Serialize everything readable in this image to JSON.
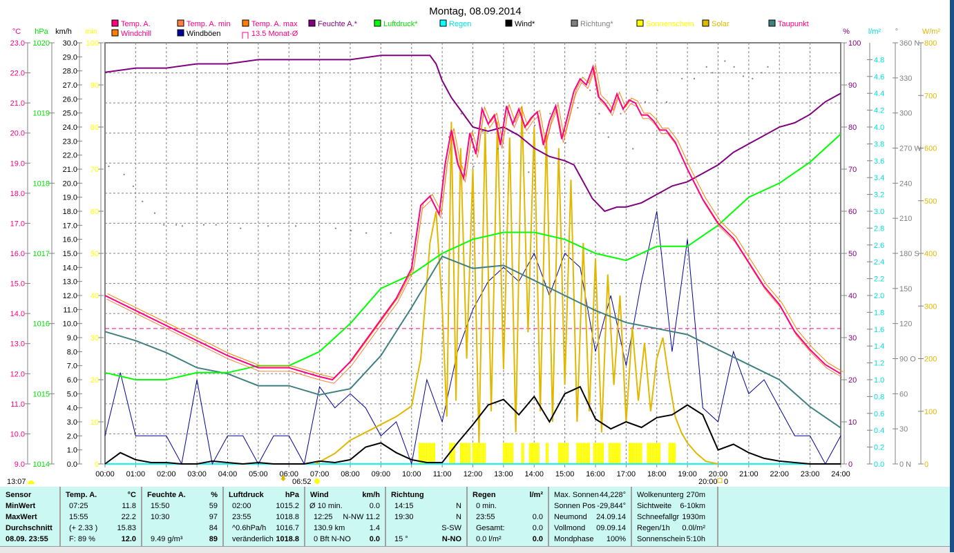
{
  "title": "Montag, 08.09.2014",
  "legend": [
    {
      "label": "Temp. A.",
      "color": "#ff0080",
      "text_color": "#ff0080"
    },
    {
      "label": "Temp. A. min",
      "color": "#ff8040",
      "text_color": "#ff0080"
    },
    {
      "label": "Temp. A. max",
      "color": "#ff8000",
      "text_color": "#ff0080"
    },
    {
      "label": "Feuchte A.*",
      "color": "#800080",
      "text_color": "#800080"
    },
    {
      "label": "Luftdruck*",
      "color": "#00ff00",
      "text_color": "#00e000"
    },
    {
      "label": "Regen",
      "color": "#00ffff",
      "text_color": "#00e0e0"
    },
    {
      "label": "Wind*",
      "color": "#000000",
      "text_color": "#000000"
    },
    {
      "label": "Richtung*",
      "color": "#808080",
      "text_color": "#808080"
    },
    {
      "label": "Sonnenschein",
      "color": "#ffff00",
      "text_color": "#ffff00"
    },
    {
      "label": "Solar",
      "color": "#e0b800",
      "text_color": "#e0b800"
    },
    {
      "label": "Taupunkt",
      "color": "#408080",
      "text_color": "#ff0080"
    },
    {
      "label": "Windchill",
      "color": "#ff8000",
      "text_color": "#ff0080"
    },
    {
      "label": "Windböen",
      "color": "#000099",
      "text_color": "#000000"
    },
    {
      "label": "13.5 Monat-Ø",
      "color": "#ff0080",
      "text_color": "#ff0080"
    }
  ],
  "axis_units": {
    "temp": "°C",
    "pressure": "hPa",
    "wind": "km/h",
    "minutes": "min",
    "humidity": "%",
    "rain": "l/m²",
    "direction": "°",
    "solar": "W/m²"
  },
  "markers": {
    "moon_time": "13:07",
    "sunrise": "06:52",
    "sunset": "20:00",
    "sunset_value": "0"
  },
  "chart_data": {
    "type": "line",
    "title": "Montag, 08.09.2014",
    "x_label": "",
    "x_ticks": [
      "00:00",
      "01:00",
      "02:00",
      "03:00",
      "04:00",
      "05:00",
      "06:00",
      "07:00",
      "08:00",
      "09:00",
      "10:00",
      "11:00",
      "12:00",
      "13:00",
      "14:00",
      "15:00",
      "16:00",
      "17:00",
      "18:00",
      "19:00",
      "20:00",
      "21:00",
      "22:00",
      "23:00",
      "24:00"
    ],
    "xlim_hours": [
      0,
      24
    ],
    "axes": {
      "temp": {
        "range": [
          9.0,
          23.0
        ],
        "step": 1.0,
        "decimals": 1,
        "color": "#ff0080"
      },
      "pressure": {
        "range": [
          1014,
          1020
        ],
        "step": 1,
        "decimals": 0,
        "color": "#00e000"
      },
      "wind": {
        "range": [
          0.0,
          30.0
        ],
        "step": 1.0,
        "decimals": 1,
        "color": "#000000"
      },
      "minutes": {
        "range": [
          0,
          100
        ],
        "step": 10,
        "decimals": 0,
        "color": "#ffff00"
      },
      "humidity": {
        "range": [
          0,
          100
        ],
        "step": 10,
        "decimals": 0,
        "color": "#800080"
      },
      "rain": {
        "range": [
          0.0,
          5.0
        ],
        "step": 0.2,
        "max_label": 4.8,
        "decimals": 1,
        "color": "#00e0e0"
      },
      "direction": {
        "range": [
          0,
          360
        ],
        "step": 30,
        "decimals": 0,
        "color": "#808080",
        "compass": {
          "0": "N",
          "90": "O",
          "180": "S",
          "270": "W",
          "360": "N"
        }
      },
      "solar": {
        "range": [
          0,
          800
        ],
        "step": 100,
        "decimals": 0,
        "color": "#e0b800"
      }
    },
    "grid": true,
    "monthly_avg_temp": 13.5,
    "series": [
      {
        "name": "Temp. A.",
        "axis": "temp",
        "color": "#ff0080",
        "x": [
          0,
          1,
          2,
          3,
          4,
          5,
          6,
          7,
          7.42,
          8,
          9,
          9.5,
          10,
          10.3,
          10.6,
          10.9,
          11.1,
          11.3,
          11.5,
          11.7,
          11.9,
          12.1,
          12.3,
          12.5,
          12.7,
          12.9,
          13.1,
          13.3,
          13.5,
          13.7,
          13.9,
          14.1,
          14.3,
          14.5,
          14.7,
          14.9,
          15.1,
          15.3,
          15.5,
          15.7,
          15.92,
          16.1,
          16.3,
          16.5,
          16.7,
          16.9,
          17.1,
          17.3,
          17.5,
          17.7,
          17.9,
          18.1,
          18.3,
          18.6,
          19,
          19.5,
          20,
          20.5,
          21,
          21.5,
          22,
          22.5,
          23,
          23.5,
          24
        ],
        "y": [
          14.6,
          14.1,
          13.6,
          13.1,
          12.6,
          12.2,
          12.2,
          11.9,
          11.8,
          12.4,
          13.8,
          14.5,
          15.5,
          17.6,
          17.9,
          17.3,
          19.0,
          20.1,
          19.0,
          18.5,
          20.0,
          19.3,
          20.8,
          20.3,
          20.6,
          19.6,
          20.9,
          20.3,
          20.8,
          20.2,
          20.5,
          20.7,
          19.6,
          20.4,
          20.9,
          19.8,
          20.6,
          21.4,
          21.8,
          21.6,
          22.2,
          21.2,
          21.0,
          20.7,
          21.3,
          20.8,
          21.1,
          21.0,
          20.6,
          20.6,
          20.4,
          20.1,
          20.1,
          19.7,
          18.8,
          17.8,
          17.0,
          16.5,
          15.7,
          14.9,
          14.3,
          13.4,
          12.8,
          12.3,
          12.0
        ]
      },
      {
        "name": "Feuchte A.*",
        "axis": "humidity",
        "color": "#800080",
        "x": [
          0,
          1,
          2,
          3,
          4,
          5,
          6,
          7,
          8,
          9,
          10,
          10.6,
          10.8,
          11,
          11.3,
          11.6,
          12,
          12.5,
          13,
          13.5,
          14,
          14.5,
          15,
          15.3,
          15.6,
          15.9,
          16.3,
          16.7,
          17,
          17.5,
          18,
          18.5,
          19,
          19.5,
          20,
          20.5,
          21,
          21.5,
          22,
          22.5,
          23,
          23.5,
          24
        ],
        "y": [
          93,
          94,
          94,
          95,
          95,
          96,
          96,
          96,
          96,
          97,
          97,
          97,
          95,
          91,
          87,
          84,
          80,
          79,
          80,
          78,
          75,
          73,
          72,
          71,
          67,
          63,
          60,
          61,
          61,
          62,
          64,
          66,
          67,
          69,
          71,
          74,
          76,
          78,
          80,
          81,
          83,
          86,
          88
        ]
      },
      {
        "name": "Luftdruck*",
        "axis": "pressure",
        "color": "#00ff00",
        "x": [
          0,
          1,
          2,
          3,
          4,
          5,
          6,
          7,
          8,
          9,
          10,
          11,
          12,
          13,
          14,
          15,
          16,
          17,
          18,
          19,
          20,
          21,
          22,
          23,
          24
        ],
        "y": [
          1015.3,
          1015.2,
          1015.2,
          1015.3,
          1015.3,
          1015.4,
          1015.4,
          1015.6,
          1016.0,
          1016.5,
          1016.7,
          1017.0,
          1017.2,
          1017.3,
          1017.3,
          1017.2,
          1017.0,
          1016.9,
          1017.1,
          1017.1,
          1017.4,
          1017.8,
          1018.0,
          1018.3,
          1018.7
        ]
      },
      {
        "name": "Taupunkt",
        "axis": "temp",
        "color": "#408080",
        "x": [
          0,
          1,
          2,
          3,
          4,
          5,
          6,
          7,
          8,
          9,
          10,
          11,
          12,
          13,
          14,
          15,
          16,
          17,
          18,
          19,
          20,
          21,
          22,
          23,
          24
        ],
        "y": [
          13.4,
          13.1,
          12.7,
          12.2,
          12.0,
          11.6,
          11.6,
          11.3,
          11.5,
          12.6,
          14.2,
          15.9,
          15.5,
          15.6,
          15.1,
          14.6,
          14.1,
          13.7,
          13.5,
          13.3,
          12.8,
          12.3,
          11.8,
          10.9,
          10.2
        ]
      },
      {
        "name": "Windböen",
        "axis": "wind",
        "color": "#000099",
        "x_step_hours": 0.5,
        "y": [
          2,
          6.5,
          2,
          2,
          2,
          0,
          6,
          0,
          2,
          2,
          0,
          2,
          2,
          0,
          5.5,
          4,
          5,
          4,
          2,
          3,
          0,
          6,
          3,
          8,
          11,
          13,
          14,
          13,
          15,
          12,
          15,
          14,
          8,
          12,
          7,
          13,
          18,
          8,
          16,
          4,
          3,
          8,
          5,
          6,
          4,
          2,
          2,
          0,
          2
        ]
      },
      {
        "name": "Wind*",
        "axis": "wind",
        "color": "#000000",
        "x_step_hours": 0.5,
        "y": [
          0,
          0.8,
          0.3,
          0.1,
          0.1,
          0,
          0,
          0.2,
          0.1,
          0,
          0.1,
          0,
          0,
          0,
          0.2,
          0.1,
          0.3,
          1.2,
          1.5,
          0.8,
          0.3,
          0.1,
          0.1,
          1.5,
          2.8,
          4.2,
          4.6,
          3.5,
          4.8,
          3.0,
          5.0,
          5.5,
          3.2,
          2.5,
          3.0,
          2.6,
          3.3,
          3.5,
          4.2,
          3.5,
          1.0,
          1.4,
          0.8,
          0.4,
          0.2,
          0.1,
          0,
          0,
          0
        ]
      },
      {
        "name": "Solar",
        "axis": "solar",
        "color": "#e0b800",
        "x": [
          6.87,
          7.5,
          8,
          8.5,
          9,
          9.5,
          10,
          10.3,
          10.6,
          10.8,
          11,
          11.15,
          11.3,
          11.45,
          11.6,
          11.8,
          12.0,
          12.2,
          12.4,
          12.6,
          12.8,
          13.0,
          13.2,
          13.4,
          13.6,
          13.8,
          14.0,
          14.2,
          14.4,
          14.6,
          14.8,
          15.0,
          15.2,
          15.4,
          15.6,
          15.8,
          16.0,
          16.2,
          16.4,
          16.6,
          16.8,
          17.0,
          17.2,
          17.4,
          17.6,
          17.8,
          18.0,
          18.2,
          18.4,
          18.6,
          18.8,
          19.0,
          19.3,
          19.6,
          20.0
        ],
        "y": [
          0,
          20,
          45,
          60,
          75,
          90,
          110,
          200,
          420,
          480,
          300,
          90,
          650,
          120,
          600,
          200,
          560,
          40,
          640,
          100,
          650,
          180,
          620,
          60,
          680,
          250,
          640,
          100,
          630,
          80,
          600,
          150,
          540,
          80,
          420,
          100,
          390,
          60,
          360,
          150,
          320,
          80,
          260,
          120,
          230,
          100,
          200,
          240,
          160,
          90,
          60,
          40,
          20,
          5,
          0
        ]
      },
      {
        "name": "Sonnenschein",
        "axis": "minutes",
        "color": "#ffff00",
        "type": "intervals",
        "value": 5,
        "intervals": [
          [
            10.25,
            10.75
          ],
          [
            11.25,
            11.4
          ],
          [
            11.6,
            11.9
          ],
          [
            12.0,
            12.4
          ],
          [
            13.0,
            13.3
          ],
          [
            13.6,
            13.65
          ],
          [
            13.85,
            14.15
          ],
          [
            14.4,
            14.45
          ],
          [
            14.8,
            15.1
          ],
          [
            15.4,
            15.8
          ],
          [
            15.95,
            16.25
          ],
          [
            16.45,
            16.8
          ],
          [
            17.1,
            17.5
          ],
          [
            17.7,
            18.1
          ],
          [
            18.4,
            18.6
          ]
        ]
      },
      {
        "name": "Richtung*",
        "axis": "direction",
        "color": "#808080",
        "type": "scatter",
        "points": [
          [
            0.1,
            255
          ],
          [
            0.6,
            248
          ],
          [
            0.9,
            238
          ],
          [
            1.2,
            225
          ],
          [
            1.6,
            215
          ],
          [
            1.9,
            205
          ],
          [
            2.3,
            205
          ],
          [
            2.5,
            204
          ],
          [
            3.2,
            205
          ],
          [
            3.6,
            205
          ],
          [
            4.4,
            202
          ],
          [
            5.3,
            204
          ],
          [
            6.2,
            204
          ],
          [
            7.5,
            202
          ],
          [
            8.0,
            200
          ],
          [
            8.5,
            198
          ],
          [
            9.3,
            198
          ],
          [
            10.0,
            195
          ],
          [
            10.6,
            230
          ],
          [
            11.2,
            280
          ],
          [
            11.6,
            300
          ],
          [
            12.0,
            255
          ],
          [
            12.3,
            285
          ],
          [
            12.8,
            270
          ],
          [
            13.3,
            290
          ],
          [
            13.8,
            250
          ],
          [
            14.0,
            290
          ],
          [
            14.5,
            300
          ],
          [
            15.0,
            275
          ],
          [
            15.4,
            305
          ],
          [
            15.8,
            320
          ],
          [
            16.1,
            300
          ],
          [
            16.4,
            280
          ],
          [
            16.8,
            300
          ],
          [
            17.2,
            270
          ],
          [
            17.6,
            310
          ],
          [
            18.0,
            320
          ],
          [
            18.3,
            310
          ],
          [
            18.8,
            330
          ],
          [
            19.2,
            330
          ],
          [
            19.6,
            340
          ],
          [
            19.8,
            335
          ],
          [
            20.2,
            345
          ],
          [
            20.5,
            340
          ],
          [
            20.8,
            332
          ],
          [
            21.1,
            330
          ],
          [
            21.4,
            335
          ],
          [
            21.6,
            340
          ]
        ]
      },
      {
        "name": "Regen",
        "axis": "rain",
        "color": "#00ffff",
        "x": [
          0,
          24
        ],
        "y": [
          0,
          0
        ]
      }
    ]
  },
  "stats": {
    "sensor": {
      "header": "Sensor",
      "rows": [
        "MinWert",
        "MaxWert",
        "Durchschnitt",
        "08.09. 23:55"
      ]
    },
    "temp": {
      "header": "Temp. A.",
      "unit": "°C",
      "left": [
        "07:25",
        "15:55",
        "(+ 2.33 )",
        "F: 89 %"
      ],
      "right": [
        "11.8",
        "22.2",
        "15.83",
        "12.0"
      ]
    },
    "humidity": {
      "header": "Feuchte A.",
      "unit": "%",
      "left": [
        "15:50",
        "10:30",
        "",
        "9.49 g/m³"
      ],
      "right": [
        "59",
        "97",
        "84",
        "89"
      ]
    },
    "pressure": {
      "header": "Luftdruck",
      "unit": "hPa",
      "left": [
        "02:00",
        "23:55",
        "^0.6hPa/h",
        "veränderlich"
      ],
      "right": [
        "1015.2",
        "1018.8",
        "1016.7",
        "1018.8"
      ]
    },
    "wind": {
      "header": "Wind",
      "unit": "km/h",
      "left": [
        "Ø 10 min.",
        "12:25",
        "130.9 km",
        "0 Bft N-NO"
      ],
      "right": [
        "0.0",
        "N-NW 11.2",
        "1.4",
        "0.0"
      ]
    },
    "direction": {
      "header": "Richtung",
      "unit": "",
      "left": [
        "14:15",
        "19:30",
        "",
        "15 °"
      ],
      "right": [
        "N",
        "N",
        "S-SW",
        "N-NO"
      ]
    },
    "rain": {
      "header": "Regen",
      "unit": "l/m²",
      "left": [
        "0 min.",
        "23:55",
        "Gesamt:",
        "0.0 l/m²"
      ],
      "right": [
        "",
        "0.0",
        "0.0",
        "0.0"
      ]
    },
    "sun": {
      "left": [
        "Max. Sonnen",
        "Sonnen Pos",
        "Neumond",
        "Vollmond",
        "Mondphase"
      ],
      "right": [
        "44,228°",
        "-29,844°",
        "24.09.14",
        "09.09.14",
        "100%"
      ]
    },
    "misc": {
      "left": [
        "Wolkenunterg",
        "Sichtweite",
        "Schneefallgr",
        "Regen/1h",
        "Sonnenschein"
      ],
      "right": [
        "270m",
        "6-10km",
        "1930m",
        "0.0l/m²",
        "5:10h"
      ]
    }
  }
}
